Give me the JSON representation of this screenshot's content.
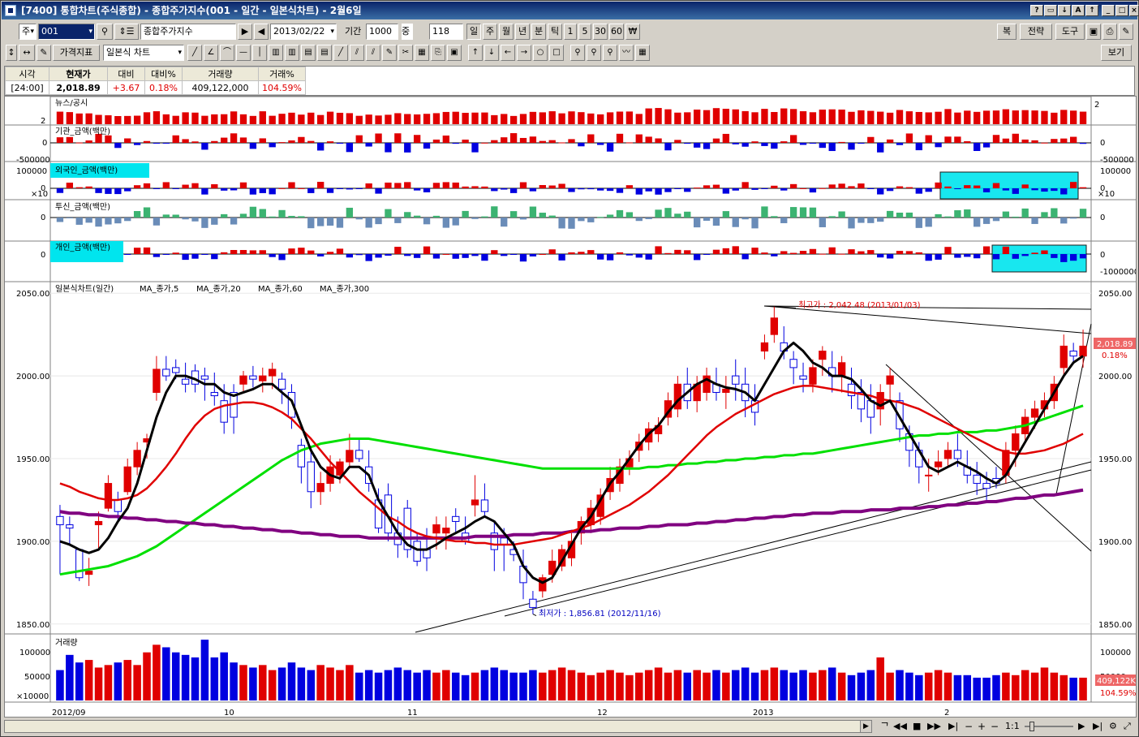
{
  "window": {
    "title": "[7400] 통합차트(주식종합) - 종합주가지수(001 - 일간 - 일본식차트) - 2월6일",
    "title_buttons": [
      "?",
      "▭",
      "↓",
      "A",
      "↑",
      "_",
      "□",
      "×"
    ]
  },
  "toolbar1": {
    "market": "주",
    "code": "001",
    "name": "종합주가지수",
    "date": "2013/02/22",
    "period_label": "기간",
    "period_value": "1000",
    "count_label": "중",
    "count_value": "118",
    "periods": [
      "일",
      "주",
      "월",
      "년",
      "분",
      "틱",
      "1",
      "5",
      "30",
      "60",
      "₩"
    ],
    "right_buttons": [
      "복",
      "전략",
      "도구"
    ]
  },
  "toolbar2": {
    "indicator_button": "가격지표",
    "chart_type": "일본식 차트",
    "right_button": "보기"
  },
  "quote": {
    "headers": [
      "시각",
      "현재가",
      "대비",
      "대비%",
      "거래량",
      "거래%"
    ],
    "values": [
      "[24:00]",
      "2,018.89",
      "+3.67",
      "0.18%",
      "409,122,000",
      "104.59%"
    ]
  },
  "panels": {
    "news": {
      "title": "뉴스/공시",
      "axis": [
        "2",
        "2"
      ]
    },
    "inst": {
      "title": "기관_금액(백만)",
      "axis_left": [
        "0",
        "-500000"
      ],
      "axis_right": [
        "0",
        "-500000"
      ]
    },
    "foreign": {
      "title": "외국인_금액(백만)",
      "axis_left": [
        "100000",
        "0"
      ],
      "axis_right": [
        "100000",
        "0"
      ],
      "scale": "×10"
    },
    "trust": {
      "title": "투신_금액(백만)",
      "axis_left": [
        "0"
      ],
      "axis_right": [
        "0"
      ]
    },
    "personal": {
      "title": "개인_금액(백만)",
      "axis_left": [
        "0"
      ],
      "axis_right": [
        "0",
        "-1000000"
      ]
    },
    "main": {
      "title": "일본식차트(일간)",
      "legend": [
        {
          "name": "MA_종가,5",
          "color": "#e00000"
        },
        {
          "name": "MA_종가,20",
          "color": "#000000"
        },
        {
          "name": "MA_종가,60",
          "color": "#e00000"
        },
        {
          "name": "MA_종가,300",
          "color": "#00c000"
        },
        {
          "name": "",
          "color": "#800080"
        }
      ],
      "y_ticks": [
        "2050.00",
        "2000.00",
        "1950.00",
        "1900.00",
        "1850.00"
      ],
      "high_note": "최고가 : 2,042.48 (2013/01/03)",
      "low_note": "최저가 : 1,856.81 (2012/11/16)",
      "last_price": "2,018.89",
      "last_pct": "0.18%"
    },
    "volume": {
      "title": "거래량",
      "y_ticks": [
        "100000",
        "50000"
      ],
      "scale": "×10000",
      "last_vol": "409,122K",
      "last_pct": "104.59%"
    }
  },
  "x_labels": [
    "2012/09",
    "10",
    "11",
    "12",
    "2013",
    "2"
  ],
  "bottom": {
    "zoom": "1:1"
  },
  "chart_data": {
    "type": "candlestick",
    "title": "일본식차트(일간)",
    "ylim": [
      1845,
      2055
    ],
    "ohlc": [
      [
        1915,
        1922,
        1880,
        1910
      ],
      [
        1910,
        1915,
        1898,
        1908
      ],
      [
        1895,
        1895,
        1876,
        1878
      ],
      [
        1880,
        1890,
        1873,
        1882
      ],
      [
        1910,
        1918,
        1895,
        1912
      ],
      [
        1920,
        1940,
        1918,
        1935
      ],
      [
        1925,
        1930,
        1912,
        1918
      ],
      [
        1930,
        1950,
        1928,
        1945
      ],
      [
        1945,
        1960,
        1940,
        1955
      ],
      [
        1960,
        1965,
        1950,
        1962
      ],
      [
        1990,
        2012,
        1985,
        2004
      ],
      [
        2004,
        2012,
        1997,
        2000
      ],
      [
        2005,
        2010,
        1998,
        2002
      ],
      [
        1998,
        2008,
        1990,
        1995
      ],
      [
        2003,
        2007,
        1990,
        1995
      ],
      [
        2000,
        2005,
        1985,
        1998
      ],
      [
        1990,
        2002,
        1982,
        1988
      ],
      [
        1985,
        1995,
        1965,
        1972
      ],
      [
        1990,
        1995,
        1965,
        1975
      ],
      [
        1995,
        2003,
        1990,
        2000
      ],
      [
        2000,
        2006,
        1993,
        1998
      ],
      [
        1997,
        2005,
        1990,
        2000
      ],
      [
        2000,
        2008,
        1992,
        2004
      ],
      [
        1998,
        2002,
        1983,
        1992
      ],
      [
        1990,
        1995,
        1968,
        1975
      ],
      [
        1958,
        1962,
        1935,
        1945
      ],
      [
        1948,
        1955,
        1920,
        1930
      ],
      [
        1930,
        1942,
        1922,
        1935
      ],
      [
        1935,
        1952,
        1930,
        1945
      ],
      [
        1940,
        1950,
        1935,
        1948
      ],
      [
        1948,
        1965,
        1945,
        1955
      ],
      [
        1955,
        1962,
        1948,
        1950
      ],
      [
        1945,
        1955,
        1930,
        1935
      ],
      [
        1925,
        1932,
        1905,
        1908
      ],
      [
        1928,
        1935,
        1900,
        1905
      ],
      [
        1905,
        1915,
        1890,
        1898
      ],
      [
        1920,
        1925,
        1890,
        1895
      ],
      [
        1900,
        1905,
        1885,
        1888
      ],
      [
        1895,
        1908,
        1882,
        1890
      ],
      [
        1905,
        1915,
        1895,
        1910
      ],
      [
        1905,
        1915,
        1895,
        1908
      ],
      [
        1915,
        1920,
        1905,
        1912
      ],
      [
        1905,
        1915,
        1898,
        1900
      ],
      [
        1922,
        1940,
        1915,
        1925
      ],
      [
        1925,
        1935,
        1915,
        1918
      ],
      [
        1905,
        1912,
        1882,
        1895
      ],
      [
        1902,
        1908,
        1882,
        1898
      ],
      [
        1895,
        1900,
        1888,
        1892
      ],
      [
        1885,
        1895,
        1865,
        1875
      ],
      [
        1865,
        1870,
        1856,
        1860
      ],
      [
        1870,
        1880,
        1866,
        1878
      ],
      [
        1880,
        1895,
        1875,
        1888
      ],
      [
        1885,
        1898,
        1882,
        1895
      ],
      [
        1890,
        1905,
        1885,
        1900
      ],
      [
        1905,
        1915,
        1898,
        1912
      ],
      [
        1910,
        1925,
        1905,
        1920
      ],
      [
        1915,
        1932,
        1910,
        1928
      ],
      [
        1930,
        1945,
        1925,
        1938
      ],
      [
        1935,
        1950,
        1930,
        1945
      ],
      [
        1945,
        1955,
        1940,
        1950
      ],
      [
        1955,
        1965,
        1948,
        1960
      ],
      [
        1960,
        1972,
        1955,
        1968
      ],
      [
        1965,
        1975,
        1960,
        1970
      ],
      [
        1975,
        1990,
        1970,
        1985
      ],
      [
        1980,
        2000,
        1975,
        1995
      ],
      [
        1995,
        2005,
        1980,
        1985
      ],
      [
        1985,
        2000,
        1978,
        1995
      ],
      [
        1990,
        2005,
        1985,
        2000
      ],
      [
        1995,
        2005,
        1985,
        1990
      ],
      [
        1990,
        2000,
        1980,
        1992
      ],
      [
        2000,
        2010,
        1985,
        1995
      ],
      [
        1995,
        2005,
        1975,
        1985
      ],
      [
        1985,
        1995,
        1970,
        1978
      ],
      [
        2015,
        2025,
        2010,
        2020
      ],
      [
        2025,
        2042,
        2020,
        2035
      ],
      [
        2020,
        2030,
        2010,
        2015
      ],
      [
        2010,
        2015,
        1995,
        2005
      ],
      [
        2000,
        2008,
        1990,
        1998
      ],
      [
        1995,
        2010,
        1990,
        2005
      ],
      [
        2010,
        2018,
        2000,
        2015
      ],
      [
        2005,
        2015,
        1990,
        2000
      ],
      [
        2000,
        2012,
        1990,
        2008
      ],
      [
        1995,
        2005,
        1980,
        1988
      ],
      [
        1990,
        1998,
        1972,
        1980
      ],
      [
        1985,
        1995,
        1965,
        1975
      ],
      [
        1980,
        1995,
        1970,
        1990
      ],
      [
        1995,
        2005,
        1985,
        2000
      ],
      [
        1985,
        1990,
        1960,
        1968
      ],
      [
        1965,
        1970,
        1945,
        1955
      ],
      [
        1955,
        1960,
        1935,
        1945
      ],
      [
        1940,
        1950,
        1930,
        1940
      ],
      [
        1945,
        1955,
        1940,
        1948
      ],
      [
        1950,
        1960,
        1945,
        1955
      ],
      [
        1955,
        1965,
        1945,
        1950
      ],
      [
        1945,
        1955,
        1935,
        1940
      ],
      [
        1940,
        1948,
        1928,
        1935
      ],
      [
        1935,
        1942,
        1925,
        1932
      ],
      [
        1938,
        1945,
        1932,
        1935
      ],
      [
        1940,
        1960,
        1935,
        1955
      ],
      [
        1955,
        1970,
        1945,
        1965
      ],
      [
        1965,
        1980,
        1960,
        1975
      ],
      [
        1975,
        1985,
        1968,
        1980
      ],
      [
        1980,
        1990,
        1975,
        1985
      ],
      [
        1985,
        2000,
        1980,
        1995
      ],
      [
        2005,
        2025,
        2000,
        2018
      ],
      [
        2015,
        2020,
        2008,
        2012
      ],
      [
        2012,
        2028,
        2005,
        2018
      ]
    ],
    "ma5": [
      1900,
      1898,
      1895,
      1893,
      1895,
      1902,
      1912,
      1920,
      1935,
      1955,
      1975,
      1990,
      2000,
      2000,
      1998,
      1995,
      1995,
      1990,
      1988,
      1990,
      1992,
      1995,
      1995,
      1990,
      1985,
      1970,
      1955,
      1945,
      1940,
      1938,
      1945,
      1945,
      1940,
      1925,
      1915,
      1905,
      1898,
      1895,
      1895,
      1898,
      1902,
      1905,
      1908,
      1912,
      1915,
      1912,
      1905,
      1898,
      1885,
      1878,
      1875,
      1878,
      1888,
      1898,
      1908,
      1915,
      1925,
      1935,
      1942,
      1950,
      1958,
      1965,
      1970,
      1978,
      1985,
      1990,
      1995,
      1998,
      1995,
      1993,
      1992,
      1990,
      1985,
      1995,
      2005,
      2015,
      2020,
      2015,
      2008,
      2005,
      2000,
      2000,
      1998,
      1992,
      1985,
      1982,
      1985,
      1975,
      1965,
      1955,
      1945,
      1942,
      1945,
      1948,
      1945,
      1942,
      1938,
      1935,
      1940,
      1950,
      1960,
      1970,
      1980,
      1990,
      2000,
      2008,
      2012
    ],
    "ma60": [
      1935,
      1933,
      1930,
      1928,
      1926,
      1925,
      1925,
      1926,
      1928,
      1932,
      1938,
      1945,
      1953,
      1962,
      1970,
      1976,
      1980,
      1982,
      1983,
      1984,
      1984,
      1983,
      1981,
      1978,
      1974,
      1968,
      1962,
      1955,
      1948,
      1942,
      1936,
      1930,
      1925,
      1920,
      1915,
      1912,
      1908,
      1905,
      1903,
      1902,
      1901,
      1900,
      1900,
      1899,
      1899,
      1898,
      1898,
      1898,
      1899,
      1900,
      1901,
      1902,
      1904,
      1906,
      1908,
      1910,
      1913,
      1916,
      1919,
      1922,
      1926,
      1930,
      1935,
      1940,
      1946,
      1952,
      1958,
      1964,
      1969,
      1973,
      1977,
      1980,
      1983,
      1986,
      1989,
      1991,
      1993,
      1994,
      1994,
      1993,
      1992,
      1991,
      1990,
      1989,
      1988,
      1986,
      1985,
      1984,
      1982,
      1980,
      1977,
      1974,
      1971,
      1968,
      1965,
      1962,
      1959,
      1956,
      1954,
      1953,
      1953,
      1954,
      1955,
      1957,
      1959,
      1962,
      1965
    ],
    "ma20": [
      1880,
      1881,
      1882,
      1883,
      1884,
      1885,
      1887,
      1889,
      1891,
      1894,
      1897,
      1901,
      1905,
      1909,
      1913,
      1917,
      1921,
      1925,
      1929,
      1933,
      1937,
      1941,
      1945,
      1949,
      1952,
      1955,
      1957,
      1959,
      1960,
      1961,
      1962,
      1962,
      1962,
      1961,
      1960,
      1959,
      1958,
      1957,
      1956,
      1955,
      1954,
      1953,
      1952,
      1951,
      1950,
      1949,
      1948,
      1947,
      1946,
      1945,
      1944,
      1944,
      1944,
      1944,
      1944,
      1944,
      1944,
      1944,
      1944,
      1944,
      1944,
      1945,
      1945,
      1946,
      1946,
      1947,
      1947,
      1948,
      1948,
      1949,
      1949,
      1950,
      1950,
      1951,
      1951,
      1952,
      1952,
      1953,
      1953,
      1954,
      1955,
      1956,
      1957,
      1958,
      1959,
      1960,
      1961,
      1962,
      1963,
      1964,
      1964,
      1965,
      1965,
      1966,
      1966,
      1966,
      1967,
      1967,
      1968,
      1969,
      1970,
      1972,
      1974,
      1976,
      1978,
      1980,
      1982
    ],
    "ma300": [
      1918,
      1917,
      1917,
      1916,
      1916,
      1915,
      1915,
      1914,
      1914,
      1913,
      1913,
      1912,
      1912,
      1911,
      1911,
      1910,
      1910,
      1909,
      1909,
      1908,
      1908,
      1907,
      1907,
      1906,
      1906,
      1905,
      1905,
      1904,
      1904,
      1903,
      1903,
      1903,
      1902,
      1902,
      1902,
      1902,
      1902,
      1902,
      1902,
      1902,
      1902,
      1902,
      1902,
      1903,
      1903,
      1903,
      1903,
      1904,
      1904,
      1904,
      1905,
      1905,
      1905,
      1906,
      1906,
      1906,
      1907,
      1907,
      1908,
      1908,
      1908,
      1909,
      1909,
      1910,
      1910,
      1910,
      1911,
      1911,
      1912,
      1912,
      1913,
      1913,
      1914,
      1914,
      1915,
      1915,
      1916,
      1916,
      1917,
      1917,
      1917,
      1918,
      1918,
      1918,
      1919,
      1919,
      1919,
      1920,
      1920,
      1920,
      1921,
      1921,
      1922,
      1922,
      1923,
      1923,
      1924,
      1924,
      1925,
      1926,
      1926,
      1927,
      1928,
      1928,
      1929,
      1930,
      1931
    ],
    "volume": [
      60,
      90,
      75,
      80,
      65,
      70,
      75,
      80,
      70,
      95,
      110,
      105,
      95,
      90,
      85,
      120,
      85,
      95,
      75,
      70,
      65,
      70,
      60,
      65,
      75,
      65,
      60,
      70,
      65,
      60,
      70,
      55,
      60,
      55,
      60,
      65,
      60,
      55,
      60,
      55,
      60,
      55,
      50,
      55,
      60,
      65,
      60,
      55,
      55,
      60,
      55,
      60,
      65,
      60,
      55,
      50,
      55,
      60,
      55,
      50,
      55,
      60,
      65,
      55,
      60,
      55,
      60,
      55,
      60,
      55,
      60,
      65,
      55,
      60,
      65,
      60,
      55,
      60,
      55,
      60,
      65,
      55,
      50,
      55,
      60,
      85,
      55,
      60,
      55,
      50,
      55,
      60,
      55,
      50,
      50,
      45,
      45,
      50,
      55,
      50,
      60,
      55,
      65,
      55,
      50,
      45,
      45
    ]
  }
}
